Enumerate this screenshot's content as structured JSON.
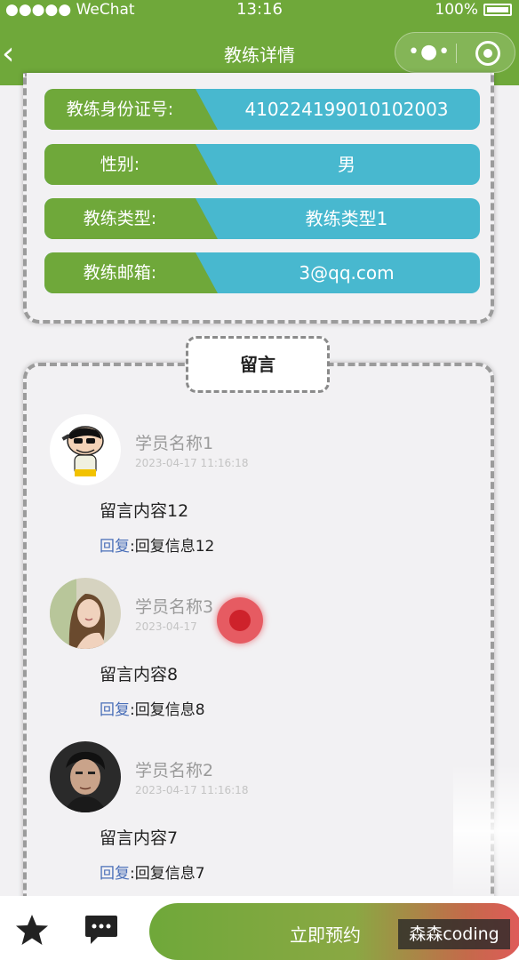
{
  "status_bar": {
    "carrier": "●●●●● WeChat",
    "wifi": "ᯤ",
    "time": "13:16",
    "battery": "100%"
  },
  "nav": {
    "back_icon": "‹",
    "title": "教练详情",
    "capsule_more": "•●•"
  },
  "info_rows": [
    {
      "label": "教练身份证号:",
      "value": "410224199010102003"
    },
    {
      "label": "性别:",
      "value": "男"
    },
    {
      "label": "教练类型:",
      "value": "教练类型1"
    },
    {
      "label": "教练邮箱:",
      "value": "3@qq.com"
    }
  ],
  "messages_tab": "留言",
  "messages": [
    {
      "name": "学员名称1",
      "time": "2023-04-17 11:16:18",
      "content": "留言内容12",
      "reply_label": "回复",
      "reply_sep": ":",
      "reply": "回复信息12"
    },
    {
      "name": "学员名称3",
      "time": "2023-04-17",
      "content": "留言内容8",
      "reply_label": "回复",
      "reply_sep": ":",
      "reply": "回复信息8"
    },
    {
      "name": "学员名称2",
      "time": "2023-04-17 11:16:18",
      "content": "留言内容7",
      "reply_label": "回复",
      "reply_sep": ":",
      "reply": "回复信息7"
    }
  ],
  "bottom": {
    "book_label": "立即预约"
  },
  "watermark": "森森coding",
  "colors": {
    "primary_green": "#6fa83a",
    "accent_teal": "#48b8cf",
    "reply_blue": "#4a6fb8"
  }
}
